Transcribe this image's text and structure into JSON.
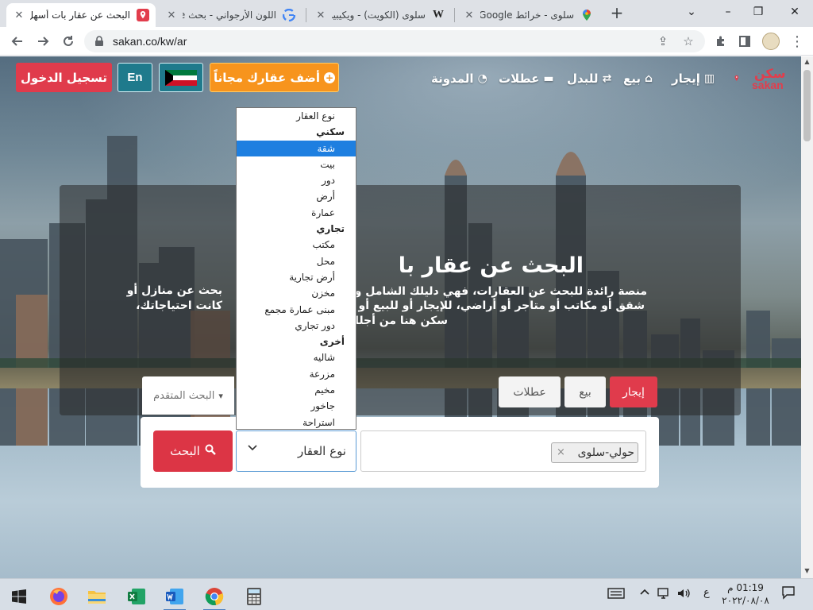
{
  "browser": {
    "tabs": [
      {
        "title": "البحث عن عقار بات أسهل",
        "active": true,
        "favicon": "map-pin-red-icon"
      },
      {
        "title": "اللون الأرجواني - بحث Google",
        "active": false,
        "favicon": "google-g-icon"
      },
      {
        "title": "سلوى (الكويت) - ويكيبيديا",
        "active": false,
        "favicon": "wikipedia-w-icon"
      },
      {
        "title": "سلوى - خرائط Google",
        "active": false,
        "favicon": "google-maps-icon"
      }
    ],
    "new_tab_label": "+",
    "close_label": "✕",
    "url": "sakan.co/kw/ar",
    "window_controls": {
      "minimize": "⌄",
      "restore": "–",
      "maximize": "❐",
      "close": "✕"
    }
  },
  "site": {
    "logo_ar": "سكن",
    "logo_en": "sakan",
    "nav": [
      {
        "label": "إيجار",
        "icon": "building-icon"
      },
      {
        "label": "بيع",
        "icon": "home-icon"
      },
      {
        "label": "للبدل",
        "icon": "exchange-icon"
      },
      {
        "label": "عطلات",
        "icon": "bed-icon"
      },
      {
        "label": "المدونة",
        "icon": "rss-icon"
      }
    ],
    "add_property": "أضف عقارك مجاناً",
    "language": "En",
    "login": "تسجيل الدخول",
    "accent_colors": {
      "red": "#e03b4c",
      "orange": "#f7941d",
      "teal": "#1f7a8c",
      "blue_selected": "#1e7fe0"
    }
  },
  "hero": {
    "title": "البحث عن عقار با",
    "description_lines": [
      "منصة رائدة للبحث عن العقارات، فهي دليلك الشامل ومرش",
      "بحث عن منازل أو",
      "شقق أو مكاتب أو متاجر أو أراضي، للإيجار أو للبيع أو لقضا",
      "كانت احتياجاتك،",
      "سكن هنا من أجلك"
    ],
    "listing_tabs": {
      "rent": "إيجار",
      "sale": "بيع",
      "holidays": "عطلات"
    },
    "advanced_search": "البحث المتقدم"
  },
  "search": {
    "button": "البحث",
    "property_type_value": "نوع العقار",
    "location_chip": "حولي-سلوى",
    "chip_remove": "×"
  },
  "dropdown": {
    "placeholder": "نوع العقار",
    "items": [
      {
        "label": "نوع العقار",
        "kind": "placeholder"
      },
      {
        "label": "سكني",
        "kind": "group"
      },
      {
        "label": "شقة",
        "kind": "option",
        "selected": true
      },
      {
        "label": "بيت",
        "kind": "option"
      },
      {
        "label": "دور",
        "kind": "option"
      },
      {
        "label": "أرض",
        "kind": "option"
      },
      {
        "label": "عمارة",
        "kind": "option"
      },
      {
        "label": "تجاري",
        "kind": "group"
      },
      {
        "label": "مكتب",
        "kind": "option"
      },
      {
        "label": "محل",
        "kind": "option"
      },
      {
        "label": "أرض تجارية",
        "kind": "option"
      },
      {
        "label": "مخزن",
        "kind": "option"
      },
      {
        "label": "مبنى عمارة مجمع",
        "kind": "option"
      },
      {
        "label": "دور تجاري",
        "kind": "option"
      },
      {
        "label": "أخرى",
        "kind": "group"
      },
      {
        "label": "شاليه",
        "kind": "option"
      },
      {
        "label": "مزرعة",
        "kind": "option"
      },
      {
        "label": "مخيم",
        "kind": "option"
      },
      {
        "label": "جاخور",
        "kind": "option"
      },
      {
        "label": "استراحة",
        "kind": "option"
      }
    ]
  },
  "taskbar": {
    "apps": [
      "windows-start-icon",
      "firefox-icon",
      "file-explorer-icon",
      "excel-icon",
      "word-icon",
      "chrome-icon",
      "calculator-icon"
    ],
    "language": "ع",
    "time": "01:19 م",
    "date": "٢٠٢٢/٠٨/٠٨"
  }
}
